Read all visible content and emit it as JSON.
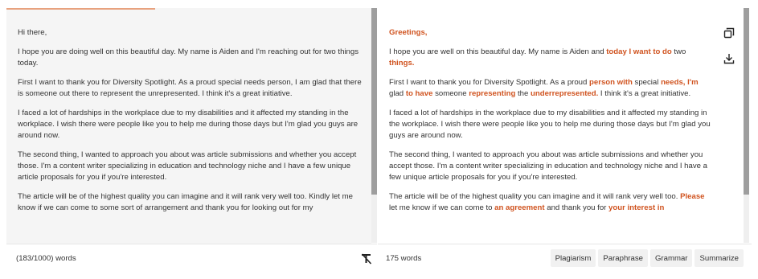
{
  "input": {
    "paragraphs": [
      "Hi there,",
      "I hope you are doing well on this beautiful day. My name is Aiden and I'm reaching out for two things today.",
      "First I want to thank you for Diversity Spotlight. As a proud special needs person, I am glad that there is someone out there to represent the unrepresented. I think it's a great initiative.",
      "I faced a lot of hardships in the workplace due to my disabilities and it affected my standing in the workplace. I wish there were people like you to help me during those days but I'm glad you guys are around now.",
      "The second thing, I wanted to approach you about was article submissions and whether you accept those. I'm a content writer specializing in education and technology niche and I have a few unique article proposals for you if you're interested.",
      "The article will be of the highest quality you can imagine and it will rank very well too. Kindly let me know if we can come to some sort of arrangement and thank you for looking out for my"
    ],
    "word_count": "(183/1000) words"
  },
  "output": {
    "paragraphs": [
      [
        {
          "t": "Greetings,",
          "hl": true
        }
      ],
      [
        {
          "t": "I hope you are well on this beautiful day. My name is Aiden and ",
          "hl": false
        },
        {
          "t": "today I want to do",
          "hl": true
        },
        {
          "t": " two ",
          "hl": false
        },
        {
          "t": "things.",
          "hl": true
        }
      ],
      [
        {
          "t": "First I want to thank you for Diversity Spotlight. As a proud ",
          "hl": false
        },
        {
          "t": "person with",
          "hl": true
        },
        {
          "t": " special ",
          "hl": false
        },
        {
          "t": "needs, I'm",
          "hl": true
        },
        {
          "t": " glad ",
          "hl": false
        },
        {
          "t": "to have",
          "hl": true
        },
        {
          "t": " someone ",
          "hl": false
        },
        {
          "t": "representing",
          "hl": true
        },
        {
          "t": " the ",
          "hl": false
        },
        {
          "t": "underrepresented.",
          "hl": true
        },
        {
          "t": " I think it's a great initiative.",
          "hl": false
        }
      ],
      [
        {
          "t": "I faced a lot of hardships in the workplace due to my disabilities and it affected my standing in the workplace. I wish there were people like you to help me during those days but I'm glad you guys are around now.",
          "hl": false
        }
      ],
      [
        {
          "t": "The second thing, I wanted to approach you about was article submissions and whether you accept those. I'm a content writer specializing in education and technology niche and I have a few unique article proposals for you if you're interested.",
          "hl": false
        }
      ],
      [
        {
          "t": "The article will be of the highest quality you can imagine and it will rank very well too. ",
          "hl": false
        },
        {
          "t": "Please",
          "hl": true
        },
        {
          "t": " let me know if we can come to ",
          "hl": false
        },
        {
          "t": "an agreement",
          "hl": true
        },
        {
          "t": " and thank you for ",
          "hl": false
        },
        {
          "t": "your interest in",
          "hl": true
        }
      ]
    ],
    "word_count": "175 words"
  },
  "actions": {
    "plagiarism": "Plagiarism",
    "paraphrase": "Paraphrase",
    "grammar": "Grammar",
    "summarize": "Summarize"
  },
  "icons": {
    "copy": "copy-icon",
    "download": "download-icon",
    "clear_format": "clear-format-icon"
  },
  "colors": {
    "highlight": "#d0531f",
    "accent_line": "#e8a27e",
    "input_background": "#f5f5f5"
  }
}
